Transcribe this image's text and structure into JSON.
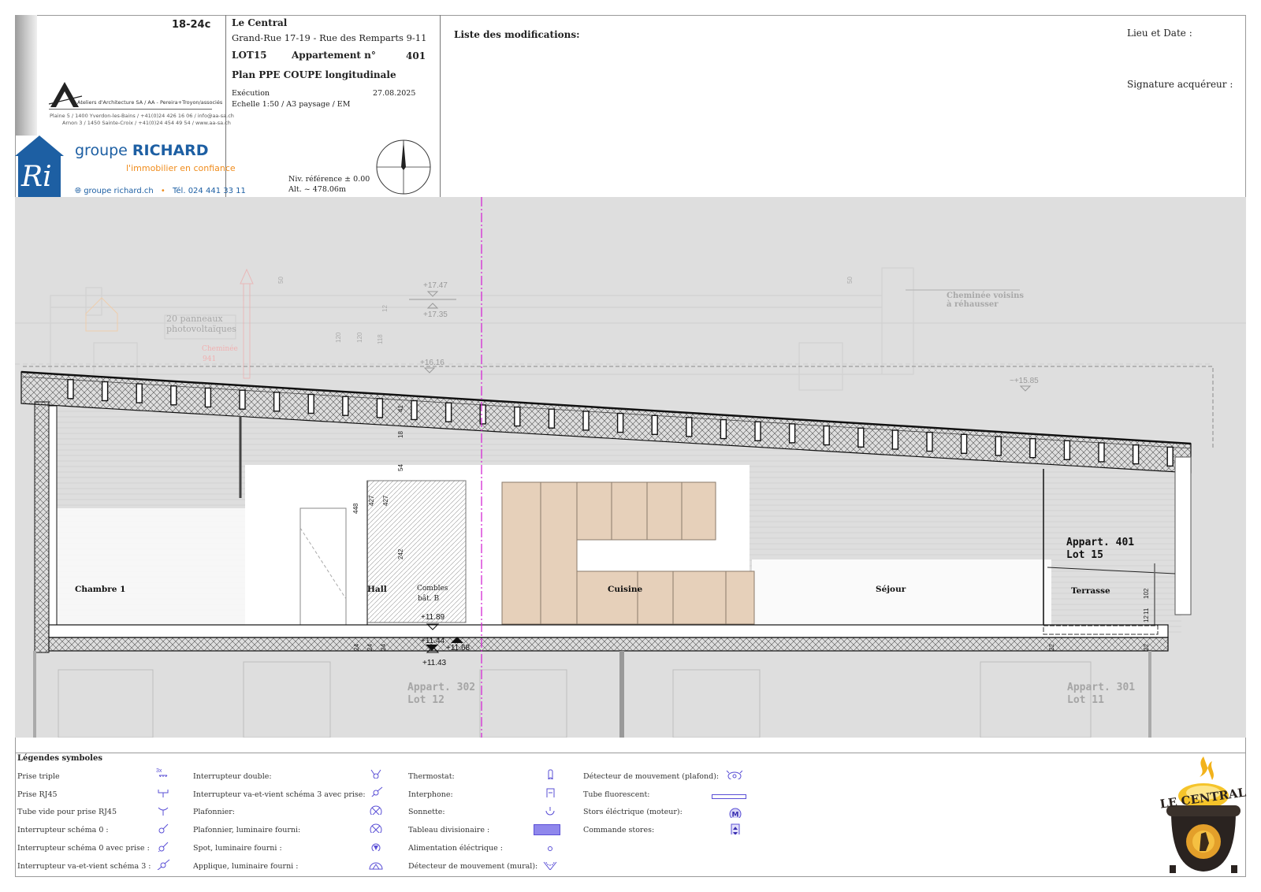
{
  "title_block": {
    "project_code": "18-24c",
    "project_name": "Le Central",
    "address": "Grand-Rue 17-19 - Rue des Remparts 9-11",
    "lot": "LOT15",
    "appartement_label": "Appartement n°",
    "appartement_number": "401",
    "plan_title": "Plan PPE COUPE longitudinale",
    "phase": "Exécution",
    "date": "27.08.2025",
    "scale": "Echelle 1:50 / A3 paysage / EM",
    "niv_reference": "Niv. référence ± 0.00",
    "altitude": "Alt. ~ 478.06m"
  },
  "architect": {
    "name_line": "Ateliers d'Architecture SA / AA - Pereira+Troyon/associés",
    "address1": "Plaine 5 / 1400 Yverdon-les-Bains / +41(0)24 426 16 06 / info@aa-sa.ch",
    "address2": "Arnon 3 / 1450 Sainte-Croix / +41(0)24 454 49 54 / www.aa-sa.ch"
  },
  "promoter": {
    "monogram": "Ri",
    "name_prefix": "groupe",
    "name_main": "RICHARD",
    "tagline": "l'immobilier en confiance",
    "website": "groupe richard.ch",
    "phone": "Tél. 024 441 33 11"
  },
  "header_right": {
    "modifications_label": "Liste des modifications:",
    "lieu_date_label": "Lieu et Date :",
    "signature_label": "Signature acquéreur :"
  },
  "drawing": {
    "rooms": {
      "chambre": "Chambre 1",
      "hall": "Hall",
      "combles": "Combles",
      "combles_sub": "bât. B",
      "cuisine": "Cuisine",
      "sejour": "Séjour",
      "terrasse": "Terrasse"
    },
    "apartment_label_line1": "Appart. 401",
    "apartment_label_line2": "Lot 15",
    "below_left_line1": "Appart. 302",
    "below_left_line2": "Lot 12",
    "below_right_line1": "Appart. 301",
    "below_right_line2": "Lot 11",
    "background_notes": {
      "panels": "20 panneaux",
      "panels2": "photovoltaïques",
      "chimney": "Cheminée voisins",
      "chimney2": "à réhausser",
      "chem_small": "Cheminée",
      "chem_small2": "941"
    },
    "levels": {
      "l1747": "+17.47",
      "l1735": "+17.35",
      "l1616": "+16.16",
      "l1585": "~+15.85",
      "l1189": "+11.89",
      "l1144": "+11.44",
      "l1168": "+11.68",
      "l1143": "+11.43"
    },
    "dims": {
      "d448": "448",
      "d427a": "427",
      "d427b": "427",
      "d242": "242",
      "d54": "54",
      "d18": "18",
      "d41": "41",
      "d120a": "120",
      "d120b": "120",
      "d118": "118",
      "d12": "12",
      "d50a": "50",
      "d50b": "50",
      "d102": "102",
      "d12b": "12",
      "d11": "11",
      "d24a": "24",
      "d24b": "24",
      "d24c": "24",
      "d22a": "22",
      "d22b": "22"
    }
  },
  "legend": {
    "title": "Légendes symboles",
    "col1": [
      "Prise triple",
      "Prise RJ45",
      "Tube vide pour prise RJ45",
      "Interrupteur schéma 0 :",
      "Interrupteur schéma 0 avec prise :",
      "Interrupteur va-et-vient schéma 3 :"
    ],
    "col2": [
      "Interrupteur double:",
      "Interrupteur va-et-vient schéma 3 avec prise:",
      "Plafonnier:",
      "Plafonnier, luminaire fourni:",
      "Spot, luminaire fourni :",
      "Applique, luminaire fourni :"
    ],
    "col3": [
      "Thermostat:",
      "Interphone:",
      "Sonnette:",
      "Tableau divisionaire :",
      "Alimentation éléctrique :",
      "Détecteur de mouvement (mural):"
    ],
    "col4": [
      "Détecteur de mouvement (plafond):",
      "Tube fluorescent:",
      "Stors éléctrique (moteur):",
      "Commande stores:"
    ],
    "triple_mark": "3x",
    "motor_mark": "M"
  },
  "logo": {
    "text": "LE CENTRAL"
  },
  "colors": {
    "promoter_blue": "#1d5fa3",
    "promoter_orange": "#f08c1c",
    "symbol_purple": "#5a4fd6",
    "axis_magenta": "#d42ad4",
    "kitchen_fill": "#e6d0ba",
    "drawing_bg": "#dedede"
  }
}
